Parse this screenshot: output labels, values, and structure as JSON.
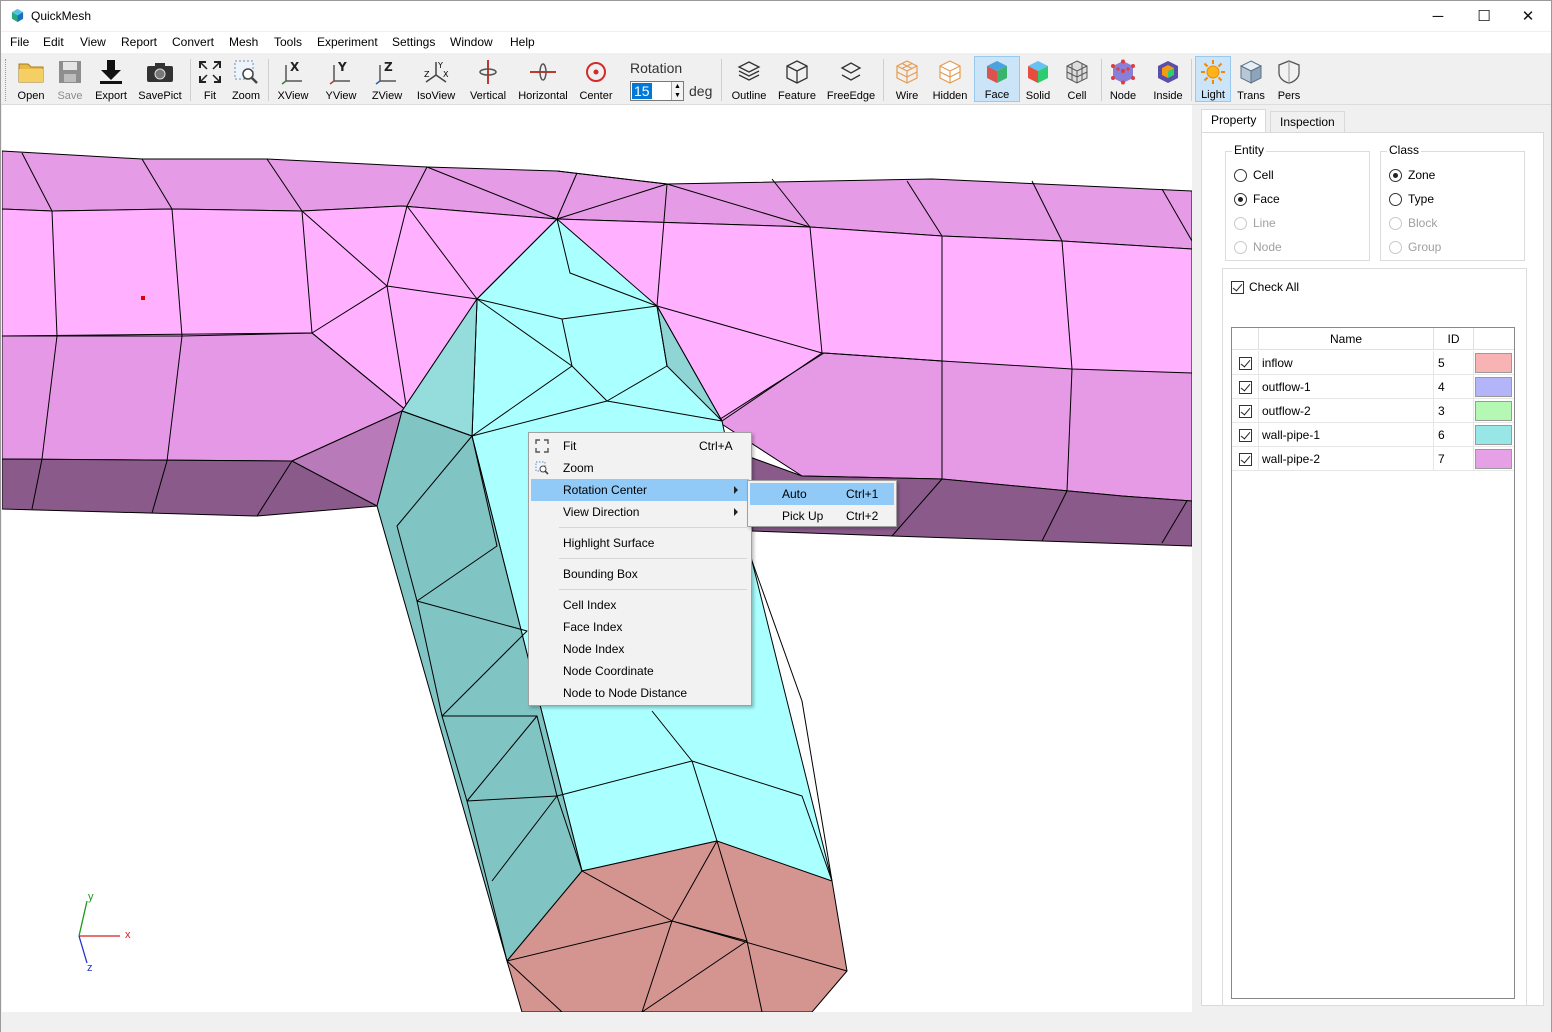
{
  "window": {
    "title": "QuickMesh",
    "minimize": "─",
    "maximize": "☐",
    "close": "✕"
  },
  "menubar": [
    "File",
    "Edit",
    "View",
    "Report",
    "Convert",
    "Mesh",
    "Tools",
    "Experiment",
    "Settings",
    "Window",
    "Help"
  ],
  "toolbar": {
    "open": "Open",
    "save": "Save",
    "export": "Export",
    "savepict": "SavePict",
    "fit": "Fit",
    "zoom": "Zoom",
    "xview": "XView",
    "yview": "YView",
    "zview": "ZView",
    "isoview": "IsoView",
    "vertical": "Vertical",
    "horizontal": "Horizontal",
    "center": "Center",
    "rotation_label": "Rotation",
    "rotation_value": "15",
    "rotation_unit": "deg",
    "outline": "Outline",
    "feature": "Feature",
    "freeedge": "FreeEdge",
    "wire": "Wire",
    "hidden": "Hidden",
    "face": "Face",
    "solid": "Solid",
    "cell": "Cell",
    "node": "Node",
    "inside": "Inside",
    "light": "Light",
    "trans": "Trans",
    "pers": "Pers"
  },
  "axes": {
    "x": "x",
    "y": "y",
    "z": "z"
  },
  "context_menu": {
    "fit": {
      "label": "Fit",
      "shortcut": "Ctrl+A"
    },
    "zoom": {
      "label": "Zoom"
    },
    "rotation_center": {
      "label": "Rotation Center"
    },
    "view_direction": {
      "label": "View Direction"
    },
    "highlight_surface": {
      "label": "Highlight Surface"
    },
    "bounding_box": {
      "label": "Bounding Box"
    },
    "cell_index": {
      "label": "Cell Index"
    },
    "face_index": {
      "label": "Face Index"
    },
    "node_index": {
      "label": "Node Index"
    },
    "node_coordinate": {
      "label": "Node Coordinate"
    },
    "node_distance": {
      "label": "Node to Node Distance"
    }
  },
  "submenu": {
    "auto": {
      "label": "Auto",
      "shortcut": "Ctrl+1"
    },
    "pickup": {
      "label": "Pick Up",
      "shortcut": "Ctrl+2"
    }
  },
  "panel": {
    "tabs": {
      "property": "Property",
      "inspection": "Inspection"
    },
    "entity": {
      "title": "Entity",
      "cell": "Cell",
      "face": "Face",
      "line": "Line",
      "node": "Node",
      "selected": "Face"
    },
    "class": {
      "title": "Class",
      "zone": "Zone",
      "type": "Type",
      "block": "Block",
      "group": "Group",
      "selected": "Zone"
    },
    "check_all": "Check All",
    "table": {
      "col_name": "Name",
      "col_id": "ID",
      "rows": [
        {
          "name": "inflow",
          "id": "5",
          "color": "#f8b4b4",
          "checked": true
        },
        {
          "name": "outflow-1",
          "id": "4",
          "color": "#b4b4f8",
          "checked": true
        },
        {
          "name": "outflow-2",
          "id": "3",
          "color": "#b4f8b4",
          "checked": true
        },
        {
          "name": "wall-pipe-1",
          "id": "6",
          "color": "#99e6e6",
          "checked": true
        },
        {
          "name": "wall-pipe-2",
          "id": "7",
          "color": "#e6a0e6",
          "checked": true
        }
      ]
    }
  }
}
